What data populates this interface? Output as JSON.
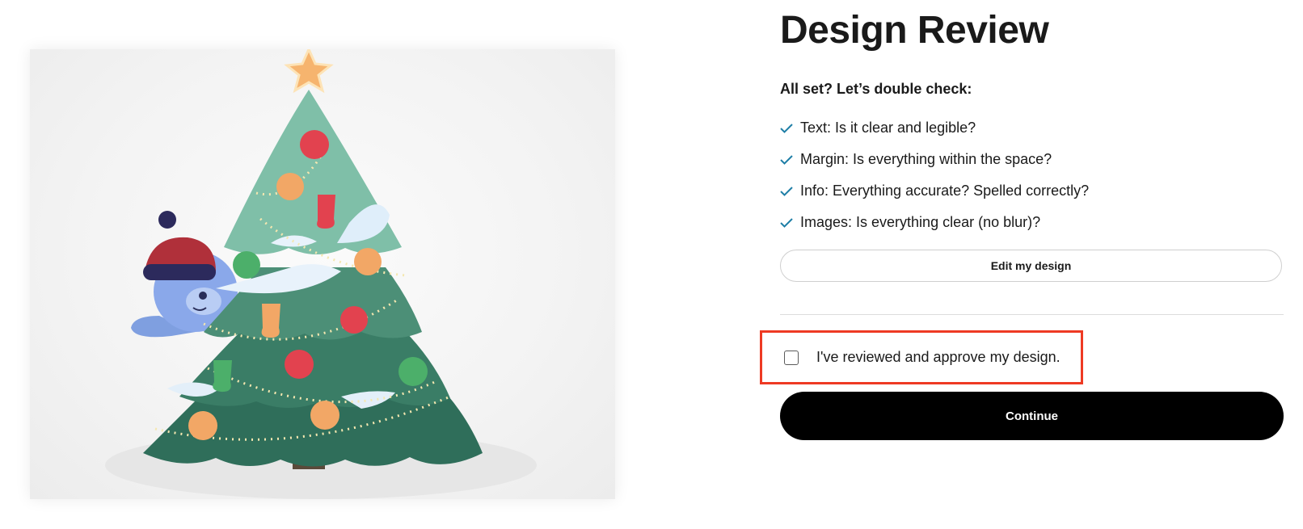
{
  "page": {
    "title": "Design Review",
    "subtitle": "All set? Let’s double check:"
  },
  "checklist": [
    {
      "label": "Text: Is it clear and legible?"
    },
    {
      "label": "Margin: Is everything within the space?"
    },
    {
      "label": "Info: Everything accurate? Spelled correctly?"
    },
    {
      "label": "Images: Is everything clear (no blur)?"
    }
  ],
  "actions": {
    "edit_label": "Edit my design",
    "approve_label": "I've reviewed and approve my design.",
    "approve_checked": false,
    "continue_label": "Continue"
  },
  "preview": {
    "image_name": "christmas-tree-card-preview"
  },
  "colors": {
    "check": "#1e7ea6",
    "highlight_border": "#ee3a23",
    "continue_bg": "#000000",
    "tree_dark": "#2f6e5a",
    "tree_light": "#7fbfa8"
  }
}
